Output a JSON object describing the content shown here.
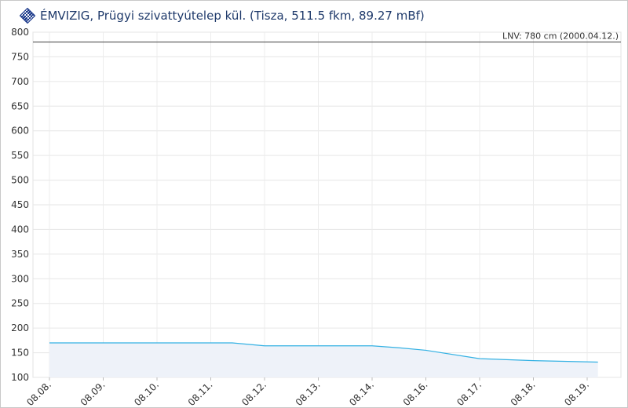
{
  "header": {
    "title": "ÉMVIZIG, Prügyi szivattyútelep kül. (Tisza, 511.5 fkm, 89.27 mBf)",
    "logo_icon": "emvizig-logo-icon"
  },
  "chart_data": {
    "type": "area",
    "title": "ÉMVIZIG, Prügyi szivattyútelep kül. (Tisza, 511.5 fkm, 89.27 mBf)",
    "xlabel": "",
    "ylabel": "",
    "ylim": [
      100,
      800
    ],
    "yticks": [
      100,
      150,
      200,
      250,
      300,
      350,
      400,
      450,
      500,
      550,
      600,
      650,
      700,
      750,
      800
    ],
    "xtick_labels": [
      "08.08.",
      "08.09.",
      "08.10.",
      "08.11.",
      "08.12.",
      "08.13.",
      "08.14.",
      "08.16.",
      "08.17.",
      "08.18.",
      "08.19."
    ],
    "grid": true,
    "series": [
      {
        "color": "#33b1e3",
        "fill": "#eef2f9",
        "x": [
          0,
          1,
          2,
          3,
          3.4,
          4,
          5,
          6,
          6.5,
          7,
          8,
          9,
          10.2
        ],
        "y": [
          170,
          170,
          170,
          170,
          170,
          164,
          164,
          164,
          160,
          155,
          138,
          134,
          131
        ]
      }
    ],
    "reference_line": {
      "label": "LNV: 780 cm (2000.04.12.)",
      "value": 780,
      "color": "#555555"
    }
  }
}
